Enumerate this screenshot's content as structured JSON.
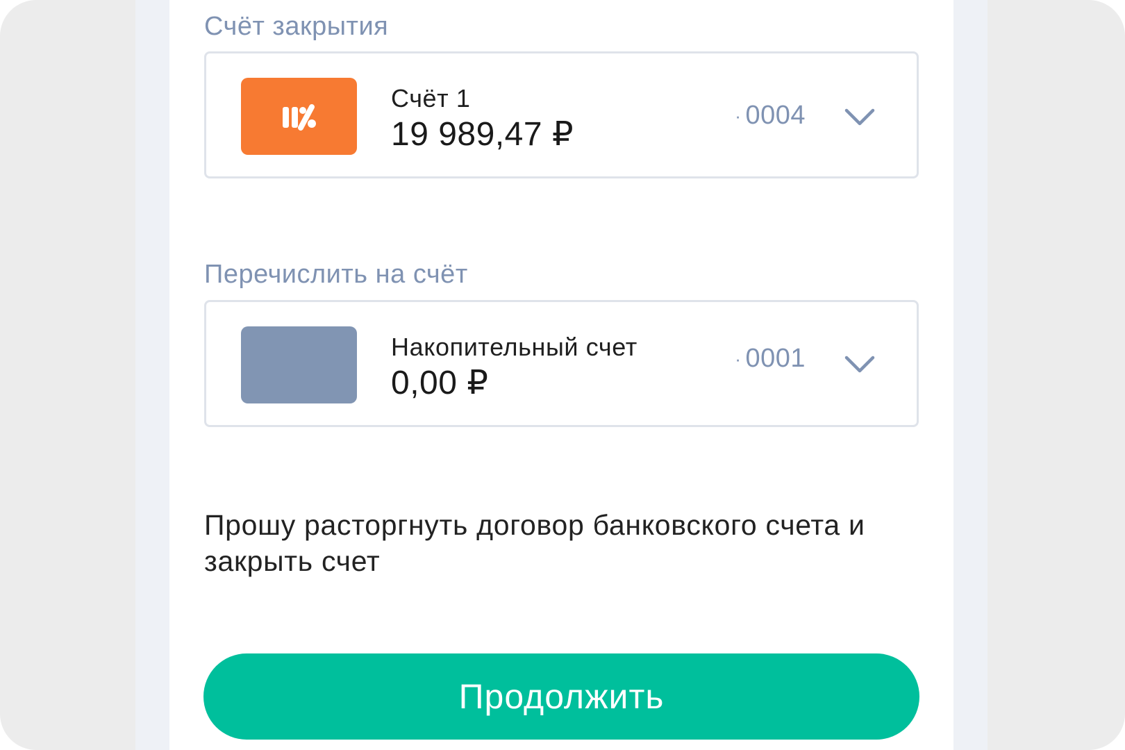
{
  "close_account_section": {
    "label": "Счёт закрытия",
    "account": {
      "name": "Счёт 1",
      "balance": "19 989,47",
      "currency": "₽",
      "number_dot": "·",
      "number": "0004",
      "thumbnail_color": "#f77a32",
      "icon": "bank-logo-icon"
    }
  },
  "transfer_section": {
    "label": "Перечислить на счёт",
    "account": {
      "name": "Накопительный счет",
      "balance": "0,00",
      "currency": "₽",
      "number_dot": "·",
      "number": "0001",
      "thumbnail_color": "#8195b3"
    }
  },
  "statement_text": "Прошу расторгнуть договор банковского счета и закрыть счет",
  "continue_button": {
    "label": "Продолжить",
    "color": "#00bf9c"
  },
  "colors": {
    "muted_label": "#7f92b2",
    "card_border": "#dfe3ea"
  }
}
